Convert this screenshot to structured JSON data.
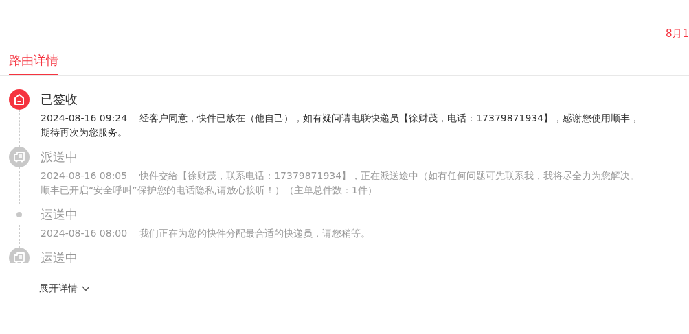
{
  "corner_text": "8月1",
  "tabs": [
    {
      "label": "路由详情",
      "selected": true
    }
  ],
  "timeline": [
    {
      "kind": "signed",
      "current": true,
      "status": "已签收",
      "time": "2024-08-16 09:24",
      "description": "经客户同意，快件已放在（他自己），如有疑问请电联快递员【徐财茂，电话：17379871934】，感谢您使用顺丰，期待再次为您服务。"
    },
    {
      "kind": "delivering",
      "current": false,
      "status": "派送中",
      "time": "2024-08-16 08:05",
      "description": "快件交给【徐财茂，联系电话：17379871934】，正在派送途中（如有任何问题可先联系我，我将尽全力为您解决。顺丰已开启“安全呼叫”保护您的电话隐私,请放心接听！）（主单总件数：1件）"
    },
    {
      "kind": "dot",
      "current": false,
      "status": "运送中",
      "time": "2024-08-16 08:00",
      "description": "我们正在为您的快件分配最合适的快递员，请您稍等。"
    },
    {
      "kind": "delivering",
      "current": false,
      "status": "运送中"
    }
  ],
  "expand_link": "展开详情"
}
